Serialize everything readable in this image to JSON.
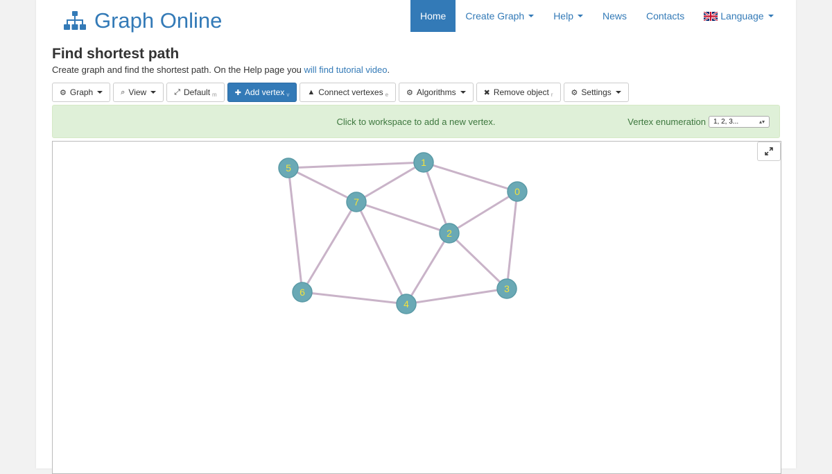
{
  "brand": {
    "name": "Graph Online",
    "icon": "sitemap-icon"
  },
  "nav": {
    "items": [
      {
        "label": "Home",
        "active": true,
        "caret": false
      },
      {
        "label": "Create Graph",
        "active": false,
        "caret": true
      },
      {
        "label": "Help",
        "active": false,
        "caret": true
      },
      {
        "label": "News",
        "active": false,
        "caret": false
      },
      {
        "label": "Contacts",
        "active": false,
        "caret": false
      },
      {
        "label": "Language",
        "active": false,
        "caret": true,
        "icon": "uk-flag-icon"
      }
    ]
  },
  "page": {
    "title": "Find shortest path",
    "subtitle_prefix": "Create graph and find the shortest path. On the Help page you ",
    "subtitle_link": "will find tutorial video",
    "subtitle_suffix": "."
  },
  "toolbar": [
    {
      "label": "Graph",
      "icon": "gear-icon",
      "caret": true,
      "hotkey": "",
      "primary": false
    },
    {
      "label": "View",
      "icon": "zoom-icon",
      "caret": true,
      "hotkey": "",
      "primary": false
    },
    {
      "label": "Default",
      "icon": "fit-icon",
      "caret": false,
      "hotkey": "m",
      "primary": false
    },
    {
      "label": "Add vertex",
      "icon": "plus-icon",
      "caret": false,
      "hotkey": "v",
      "primary": true
    },
    {
      "label": "Connect vertexes",
      "icon": "road-icon",
      "caret": false,
      "hotkey": "e",
      "primary": false
    },
    {
      "label": "Algorithms",
      "icon": "gear-icon",
      "caret": true,
      "hotkey": "",
      "primary": false
    },
    {
      "label": "Remove object",
      "icon": "remove-icon",
      "caret": false,
      "hotkey": "r",
      "primary": false
    },
    {
      "label": "Settings",
      "icon": "gear-icon",
      "caret": true,
      "hotkey": "",
      "primary": false
    }
  ],
  "infobar": {
    "message": "Click to workspace to add a new vertex.",
    "enum_label": "Vertex enumeration",
    "enum_value": "1, 2, 3..."
  },
  "graph": {
    "vertex_color": "#6aa9b5",
    "vertex_label_color": "#f4e23c",
    "edge_color": "#c9b3c8",
    "vertices": [
      {
        "id": "0",
        "label": "0"
      },
      {
        "id": "1",
        "label": "1"
      },
      {
        "id": "2",
        "label": "2"
      },
      {
        "id": "3",
        "label": "3"
      },
      {
        "id": "4",
        "label": "4"
      },
      {
        "id": "5",
        "label": "5"
      },
      {
        "id": "6",
        "label": "6"
      },
      {
        "id": "7",
        "label": "7"
      }
    ],
    "edges": [
      [
        "5",
        "1"
      ],
      [
        "5",
        "7"
      ],
      [
        "5",
        "6"
      ],
      [
        "1",
        "7"
      ],
      [
        "1",
        "0"
      ],
      [
        "1",
        "2"
      ],
      [
        "7",
        "2"
      ],
      [
        "7",
        "6"
      ],
      [
        "7",
        "4"
      ],
      [
        "0",
        "2"
      ],
      [
        "0",
        "3"
      ],
      [
        "2",
        "4"
      ],
      [
        "2",
        "3"
      ],
      [
        "6",
        "4"
      ],
      [
        "4",
        "3"
      ]
    ]
  },
  "colors": {
    "accent": "#337ab7",
    "info_bg": "#dff0d8",
    "info_text": "#3c763d"
  }
}
